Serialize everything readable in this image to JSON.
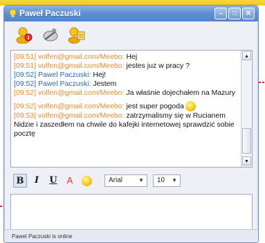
{
  "window": {
    "title": "Paweł Paczuski",
    "minimize_glyph": "–",
    "maximize_glyph": "□",
    "close_glyph": "✕"
  },
  "toolbar": {
    "icons": [
      "buddy-info-icon",
      "block-user-icon",
      "send-file-icon"
    ]
  },
  "chat": {
    "messages": [
      {
        "time": "[09:51]",
        "sender": "volfen@gmail.com/Meebo:",
        "text": "Hej",
        "color": "orange"
      },
      {
        "time": "[09:51]",
        "sender": "volfen@gmail.com/Meebo:",
        "text": "jestes juz w pracy ?",
        "color": "orange"
      },
      {
        "time": "[09:52]",
        "sender": "Pawel Paczuski:",
        "text": "Hej!",
        "color": "blue"
      },
      {
        "time": "[09:52]",
        "sender": "Pawel Paczuski:",
        "text": "Jestem",
        "color": "blue"
      },
      {
        "time": "[09:52]",
        "sender": "volfen@gmail.com/Meebo:",
        "text": "Ja właśnie dojechałem na Mazury",
        "color": "orange"
      },
      {
        "time": "[09:52]",
        "sender": "volfen@gmail.com/Meebo:",
        "text": "jest super pogoda",
        "color": "orange",
        "smiley": true
      },
      {
        "time": "[09:53]",
        "sender": "volfen@gmail.com/Meebo:",
        "text": "zatrzymalismy się w Rucianem Nidzie i zaszedłem na chwile do kafejki internetowej sprawdzić sobie pocztę",
        "color": "orange"
      }
    ]
  },
  "format": {
    "bold": "B",
    "italic": "I",
    "underline": "U",
    "color": "A",
    "font": "Arial",
    "size": "10"
  },
  "status": "Pawel Paczuski is online",
  "colors": {
    "accent_orange": "#e48a2b",
    "accent_blue": "#2f66b8",
    "titlebar": "#5f8fd1",
    "callout_red": "#e02020"
  }
}
